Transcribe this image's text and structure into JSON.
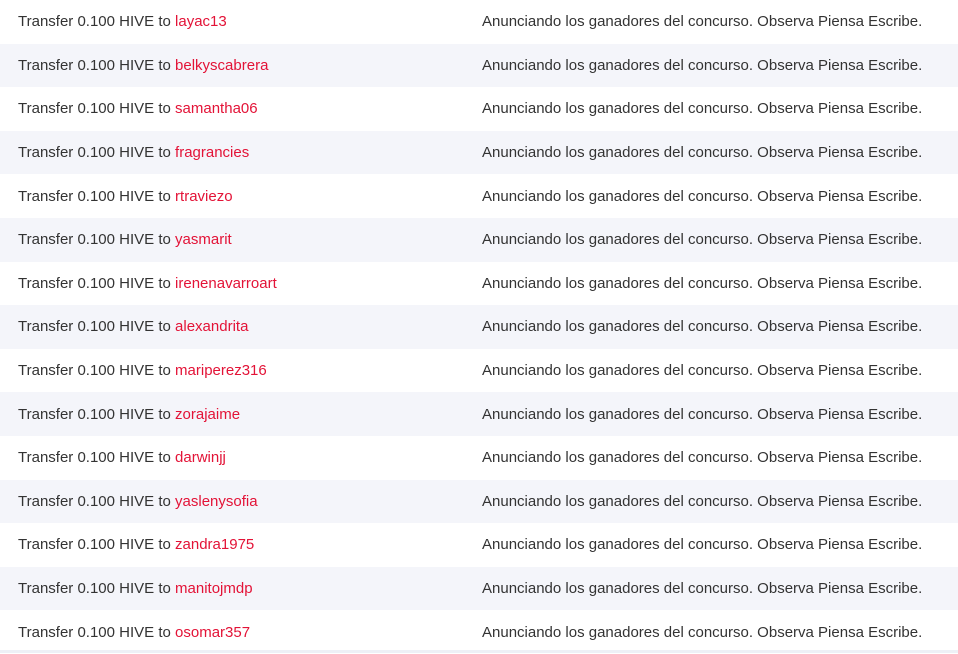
{
  "colors": {
    "link": "#e31337",
    "text": "#333333",
    "row_shade": "#f4f5fa"
  },
  "transfers": [
    {
      "prefix": "Transfer 0.100 HIVE to",
      "account": "layac13",
      "memo": "Anunciando los ganadores del concurso. Observa Piensa Escribe."
    },
    {
      "prefix": "Transfer 0.100 HIVE to",
      "account": "belkyscabrera",
      "memo": "Anunciando los ganadores del concurso. Observa Piensa Escribe."
    },
    {
      "prefix": "Transfer 0.100 HIVE to",
      "account": "samantha06",
      "memo": "Anunciando los ganadores del concurso. Observa Piensa Escribe."
    },
    {
      "prefix": "Transfer 0.100 HIVE to",
      "account": "fragrancies",
      "memo": "Anunciando los ganadores del concurso. Observa Piensa Escribe."
    },
    {
      "prefix": "Transfer 0.100 HIVE to",
      "account": "rtraviezo",
      "memo": "Anunciando los ganadores del concurso. Observa Piensa Escribe."
    },
    {
      "prefix": "Transfer 0.100 HIVE to",
      "account": "yasmarit",
      "memo": "Anunciando los ganadores del concurso. Observa Piensa Escribe."
    },
    {
      "prefix": "Transfer 0.100 HIVE to",
      "account": "irenenavarroart",
      "memo": "Anunciando los ganadores del concurso. Observa Piensa Escribe."
    },
    {
      "prefix": "Transfer 0.100 HIVE to",
      "account": "alexandrita",
      "memo": "Anunciando los ganadores del concurso. Observa Piensa Escribe."
    },
    {
      "prefix": "Transfer 0.100 HIVE to",
      "account": "mariperez316",
      "memo": "Anunciando los ganadores del concurso. Observa Piensa Escribe."
    },
    {
      "prefix": "Transfer 0.100 HIVE to",
      "account": "zorajaime",
      "memo": "Anunciando los ganadores del concurso. Observa Piensa Escribe."
    },
    {
      "prefix": "Transfer 0.100 HIVE to",
      "account": "darwinjj",
      "memo": "Anunciando los ganadores del concurso. Observa Piensa Escribe."
    },
    {
      "prefix": "Transfer 0.100 HIVE to",
      "account": "yaslenysofia",
      "memo": "Anunciando los ganadores del concurso. Observa Piensa Escribe."
    },
    {
      "prefix": "Transfer 0.100 HIVE to",
      "account": "zandra1975",
      "memo": "Anunciando los ganadores del concurso. Observa Piensa Escribe."
    },
    {
      "prefix": "Transfer 0.100 HIVE to",
      "account": "manitojmdp",
      "memo": "Anunciando los ganadores del concurso. Observa Piensa Escribe."
    },
    {
      "prefix": "Transfer 0.100 HIVE to",
      "account": "osomar357",
      "memo": "Anunciando los ganadores del concurso. Observa Piensa Escribe."
    }
  ]
}
